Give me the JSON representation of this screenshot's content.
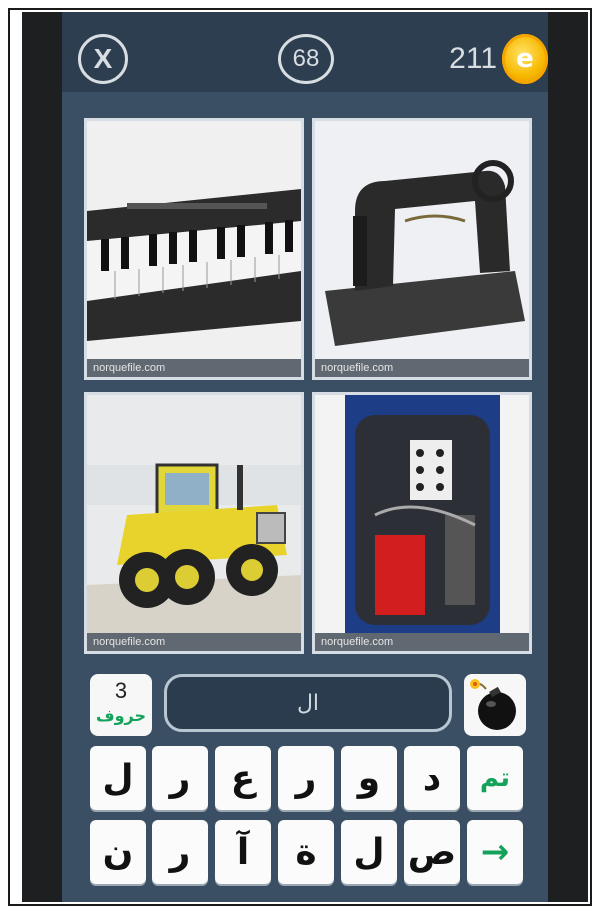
{
  "header": {
    "close_label": "X",
    "level": "68",
    "coins": "211",
    "coin_symbol": "e"
  },
  "photos": [
    {
      "caption": "norquefile.com"
    },
    {
      "caption": "norquefile.com"
    },
    {
      "caption": "norquefile.com"
    },
    {
      "caption": "norquefile.com"
    }
  ],
  "hint": {
    "count": "3",
    "label": "حروف"
  },
  "answer": {
    "value": "ال"
  },
  "keyboard": {
    "row1": [
      "تم",
      "د",
      "و",
      "ر",
      "ع",
      "ر",
      "ل"
    ],
    "row2": [
      "→",
      "ص",
      "ل",
      "ة",
      "آ",
      "ر",
      "ن"
    ]
  },
  "colors": {
    "background": "#3a4f63",
    "topbar": "#2c3e4f",
    "accent_green": "#14a25b",
    "coin": "#f7b900"
  }
}
